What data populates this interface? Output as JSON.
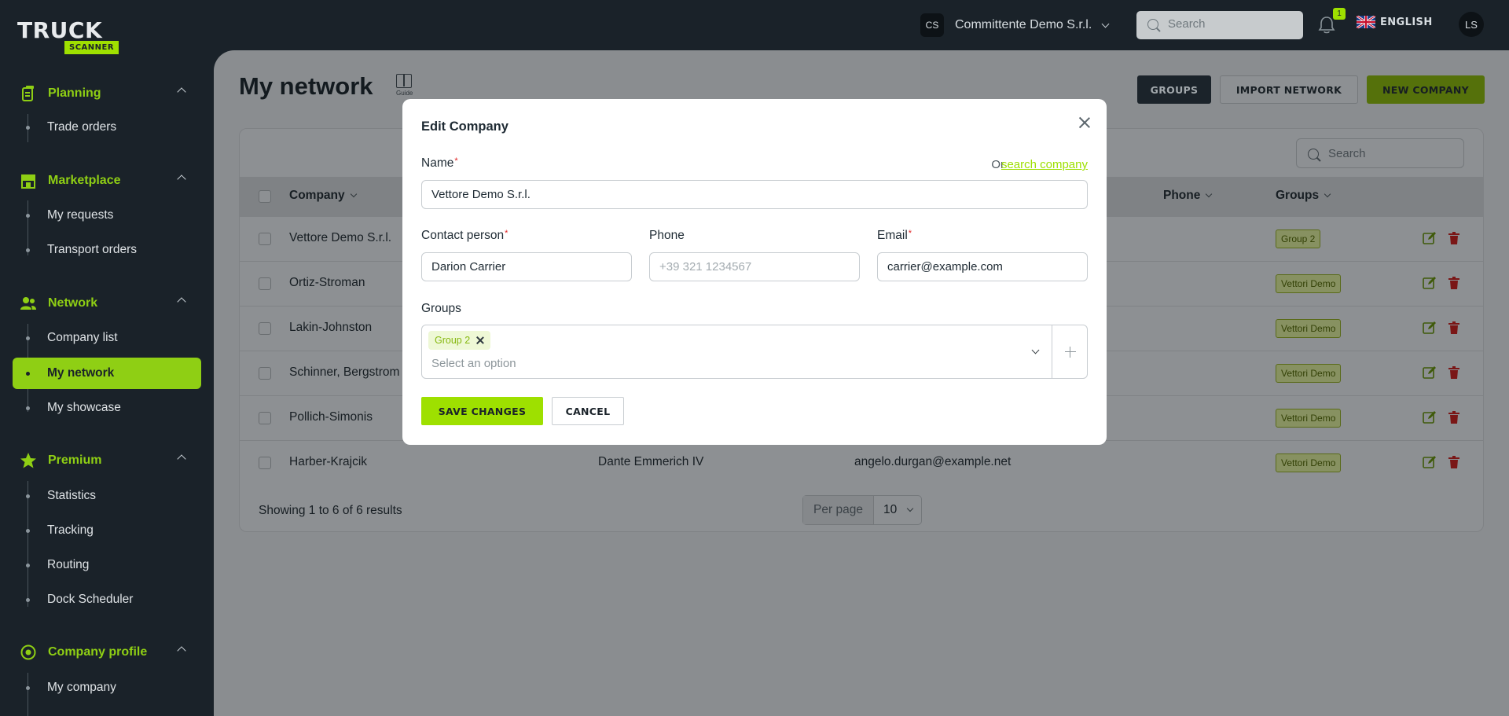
{
  "brand": {
    "line1": "TRUCK",
    "line2": "SCANNER"
  },
  "sidebar": {
    "sections": [
      {
        "title": "Planning",
        "icon": "clipboard-icon",
        "items": [
          "Trade orders"
        ]
      },
      {
        "title": "Marketplace",
        "icon": "store-icon",
        "items": [
          "My requests",
          "Transport orders"
        ]
      },
      {
        "title": "Network",
        "icon": "users-icon",
        "items": [
          "Company list",
          "My network",
          "My showcase"
        ]
      },
      {
        "title": "Premium",
        "icon": "star-icon",
        "items": [
          "Statistics",
          "Tracking",
          "Routing",
          "Dock Scheduler"
        ]
      },
      {
        "title": "Company profile",
        "icon": "settings-icon",
        "items": [
          "My company"
        ]
      }
    ],
    "active_item": "My network"
  },
  "topbar": {
    "company_initials": "CS",
    "company_name": "Committente Demo S.r.l.",
    "search_placeholder": "Search",
    "notifications_count": "1",
    "language": "ENGLISH",
    "user_initials": "LS"
  },
  "page": {
    "title": "My network",
    "guide_label": "Guide",
    "buttons": {
      "groups": "GROUPS",
      "import": "IMPORT NETWORK",
      "new_company": "NEW COMPANY"
    }
  },
  "table": {
    "search_placeholder": "Search",
    "headers": {
      "company": "Company",
      "phone": "Phone",
      "groups": "Groups"
    },
    "rows": [
      {
        "company": "Vettore Demo S.r.l.",
        "contact": "",
        "email": "",
        "group": "Group 2"
      },
      {
        "company": "Ortiz-Stroman",
        "contact": "",
        "email": "",
        "group": "Vettori Demo"
      },
      {
        "company": "Lakin-Johnston",
        "contact": "",
        "email": "",
        "group": "Vettori Demo"
      },
      {
        "company": "Schinner, Bergstrom",
        "contact": "",
        "email": "",
        "group": "Vettori Demo"
      },
      {
        "company": "Pollich-Simonis",
        "contact": "",
        "email": "",
        "group": "Vettori Demo"
      },
      {
        "company": "Harber-Krajcik",
        "contact": "Dante Emmerich IV",
        "email": "angelo.durgan@example.net",
        "group": "Vettori Demo"
      }
    ],
    "footer": {
      "showing": "Showing 1 to 6 of 6 results",
      "per_page_label": "Per page",
      "per_page_value": "10"
    }
  },
  "modal": {
    "title": "Edit Company",
    "name_label": "Name",
    "name_value": "Vettore Demo S.r.l.",
    "or_text": "Or",
    "search_link": "search company",
    "contact_label": "Contact person",
    "contact_value": "Darion Carrier",
    "phone_label": "Phone",
    "phone_placeholder": "+39 321 1234567",
    "email_label": "Email",
    "email_value": "carrier@example.com",
    "groups_label": "Groups",
    "selected_group": "Group 2",
    "groups_placeholder": "Select an option",
    "save_label": "SAVE CHANGES",
    "cancel_label": "CANCEL",
    "required_mark": "*"
  },
  "colors": {
    "accent": "#9ee000",
    "sidebar_bg": "#1a2229",
    "danger": "#e02424"
  }
}
